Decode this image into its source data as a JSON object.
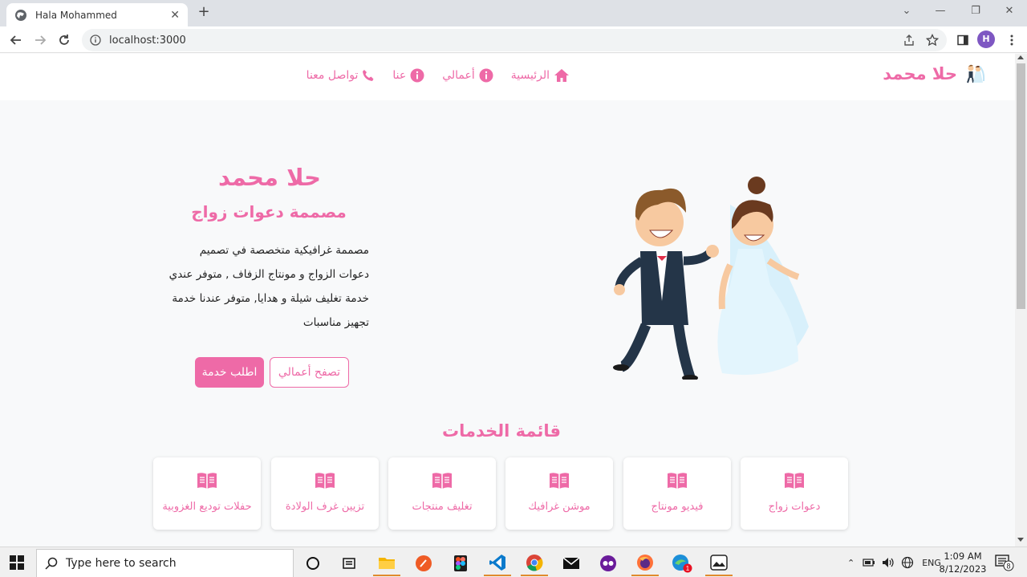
{
  "browser": {
    "tab_title": "Hala Mohammed",
    "new_tab_symbol": "+",
    "url": "localhost:3000",
    "profile_initial": "H"
  },
  "site": {
    "brand": "حلا محمد",
    "nav": {
      "home": "الرئيسية",
      "works": "أعمالي",
      "about": "عنا",
      "contact": "تواصل معنا"
    },
    "hero": {
      "title": "حلا محمد",
      "subtitle": "مصممة دعوات زواج",
      "description": "مصممة غرافيكية متخصصة في تصميم دعوات الزواج و مونتاج الزفاف , متوفر عندي خدمة تغليف شيلة و هدايا, متوفر عندنا خدمة تجهيز مناسبات",
      "browse_button": "تصفح أعمالي",
      "request_button": "اطلب خدمة"
    },
    "services": {
      "title": "قائمة الخدمات",
      "items": [
        {
          "label": "دعوات زواج",
          "icon": "book-icon"
        },
        {
          "label": "فيديو مونتاج",
          "icon": "book-icon"
        },
        {
          "label": "موشن غرافيك",
          "icon": "book-icon"
        },
        {
          "label": "تغليف منتجات",
          "icon": "book-icon"
        },
        {
          "label": "تزيين غرف الولادة",
          "icon": "book-icon"
        },
        {
          "label": "حفلات توديع الغزوبية",
          "icon": "book-icon"
        }
      ]
    },
    "accent_color": "#ee6aa7"
  },
  "taskbar": {
    "search_placeholder": "Type here to search",
    "language": "ENG",
    "time": "1:09 AM",
    "date": "8/12/2023",
    "notification_count": "8",
    "store_badge": "1"
  }
}
